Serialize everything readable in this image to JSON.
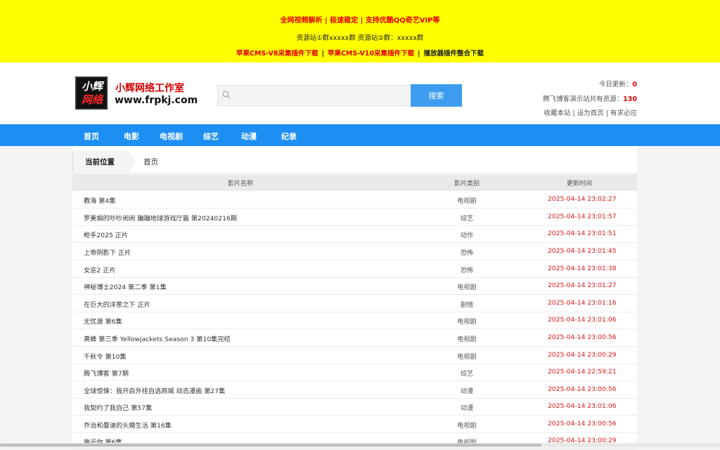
{
  "banner": {
    "line1": "全网视频解析 | 极速稳定 | 支持优酷QQ奇艺VIP等",
    "line2": "资源站①群xxxxx群  资源站②群：xxxxx群",
    "links": [
      "苹果CMS-V8采集插件下载",
      "苹果CMS-V10采集插件下载",
      "播放器插件整合下载"
    ]
  },
  "brand": {
    "logo_top": "小辉",
    "logo_bottom": "网络",
    "name": "小辉网络工作室",
    "url": "www.frpkj.com"
  },
  "search": {
    "placeholder": "",
    "button": "搜索"
  },
  "stats": {
    "today_label": "今日更新：",
    "today_value": "0",
    "total_label": "腾飞博客演示站共有资源：",
    "total_value": "130",
    "links": [
      "收藏本站",
      "设为首页",
      "有求必应"
    ],
    "sep": "|"
  },
  "nav": [
    "首页",
    "电影",
    "电视剧",
    "综艺",
    "动漫",
    "纪录"
  ],
  "crumb": {
    "label": "当前位置",
    "current": "首页"
  },
  "table": {
    "headers": [
      "影片名称",
      "影片类别",
      "更新时间"
    ],
    "rows": [
      {
        "name": "教海 第4集",
        "cat": "电视剧",
        "time": "2025-04-14 23:02:27"
      },
      {
        "name": "罗美娟的吵吵闹闹 蹦蹦地球游戏厅篇 第20240216期",
        "cat": "综艺",
        "time": "2025-04-14 23:01:57"
      },
      {
        "name": "枪手2025 正片",
        "cat": "动作",
        "time": "2025-04-14 23:01:51"
      },
      {
        "name": "上帝阴影下 正片",
        "cat": "恐怖",
        "time": "2025-04-14 23:01:45"
      },
      {
        "name": "女巫2 正片",
        "cat": "恐怖",
        "time": "2025-04-14 23:01:38"
      },
      {
        "name": "神秘博士2024 第二季 第1集",
        "cat": "电视剧",
        "time": "2025-04-14 23:01:27"
      },
      {
        "name": "在巨大的洋葱之下 正片",
        "cat": "剧情",
        "time": "2025-04-14 23:01:16"
      },
      {
        "name": "无忧渡 第6集",
        "cat": "电视剧",
        "time": "2025-04-14 23:01:06"
      },
      {
        "name": "黄蜂 第三季 Yellowjackets Season 3 第10集完结",
        "cat": "电视剧",
        "time": "2025-04-14 23:00:56"
      },
      {
        "name": "千秋令 第10集",
        "cat": "电视剧",
        "time": "2025-04-14 23:00:29"
      },
      {
        "name": "腾飞博客 第7期",
        "cat": "综艺",
        "time": "2025-04-14 22:59:21"
      },
      {
        "name": "全球惊悚：我开启外挂自选商城 动态漫画 第27集",
        "cat": "动漫",
        "time": "2025-04-14 23:00:56"
      },
      {
        "name": "我契约了我自己 第57集",
        "cat": "动漫",
        "time": "2025-04-14 23:01:06"
      },
      {
        "name": "乔治和曼迪的头婚生活 第16集",
        "cat": "电视剧",
        "time": "2025-04-14 23:00:56"
      },
      {
        "name": "靠近你 第6集",
        "cat": "电视剧",
        "time": "2025-04-14 23:00:29"
      }
    ]
  }
}
